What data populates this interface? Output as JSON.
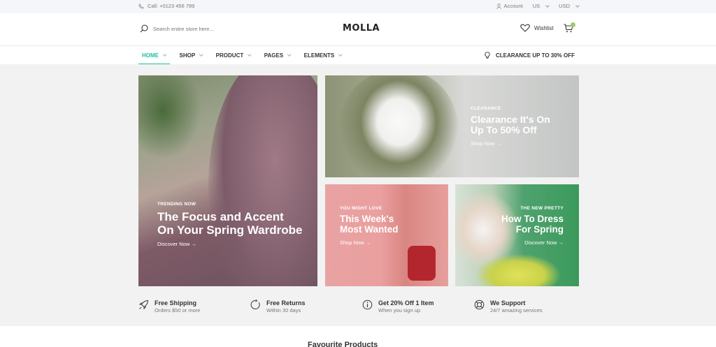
{
  "topbar": {
    "call": "Call: +0123 456 789",
    "account": "Account",
    "lang": "US",
    "currency": "USD"
  },
  "header": {
    "search_placeholder": "Search entire store here...",
    "logo": "MOLLA",
    "wishlist": "Wishlist"
  },
  "nav": {
    "items": [
      {
        "label": "HOME"
      },
      {
        "label": "SHOP"
      },
      {
        "label": "PRODUCT"
      },
      {
        "label": "PAGES"
      },
      {
        "label": "ELEMENTS"
      }
    ],
    "clearance": "CLEARANCE UP TO 30% OFF"
  },
  "banners": {
    "main": {
      "sub": "TRENDING NOW",
      "title1": "The Focus and Accent",
      "title2": "On Your Spring Wardrobe",
      "btn": "Discover Now →"
    },
    "clearance": {
      "sub": "CLEARANCE",
      "title1": "Clearance It's On",
      "title2": "Up To 50% Off",
      "btn": "Shop Now →"
    },
    "week": {
      "sub": "YOU MIGHT LOVE",
      "title1": "This Week's",
      "title2": "Most Wanted",
      "btn": "Shop Now →"
    },
    "pretty": {
      "sub": "THE NEW PRETTY",
      "title1": "How To Dress",
      "title2": "For Spring",
      "btn": "Discover Now →"
    }
  },
  "features": [
    {
      "title": "Free Shipping",
      "sub": "Orders $50 or more",
      "icon": "rocket-icon"
    },
    {
      "title": "Free Returns",
      "sub": "Within 30 days",
      "icon": "returns-icon"
    },
    {
      "title": "Get 20% Off 1 Item",
      "sub": "When you sign up",
      "icon": "info-icon"
    },
    {
      "title": "We Support",
      "sub": "24/7 amazing services",
      "icon": "support-icon"
    }
  ],
  "below": "Favourite Products"
}
